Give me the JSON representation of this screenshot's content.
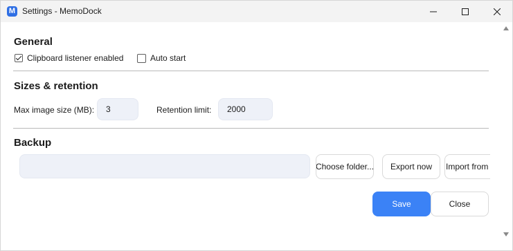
{
  "window": {
    "title": "Settings - MemoDock",
    "app_icon_letter": "M",
    "accent_color": "#3b82f6"
  },
  "general": {
    "title": "General",
    "clipboard_listener": {
      "label": "Clipboard listener enabled",
      "checked": true
    },
    "auto_start": {
      "label": "Auto start",
      "checked": false
    }
  },
  "sizes": {
    "title": "Sizes & retention",
    "max_image_label": "Max image size (MB):",
    "max_image_value": "3",
    "retention_label": "Retention limit:",
    "retention_value": "2000"
  },
  "backup": {
    "title": "Backup",
    "folder_path": "",
    "choose_folder_label": "Choose folder...",
    "export_label": "Export now",
    "import_label": "Import from"
  },
  "footer": {
    "save_label": "Save",
    "close_label": "Close"
  }
}
